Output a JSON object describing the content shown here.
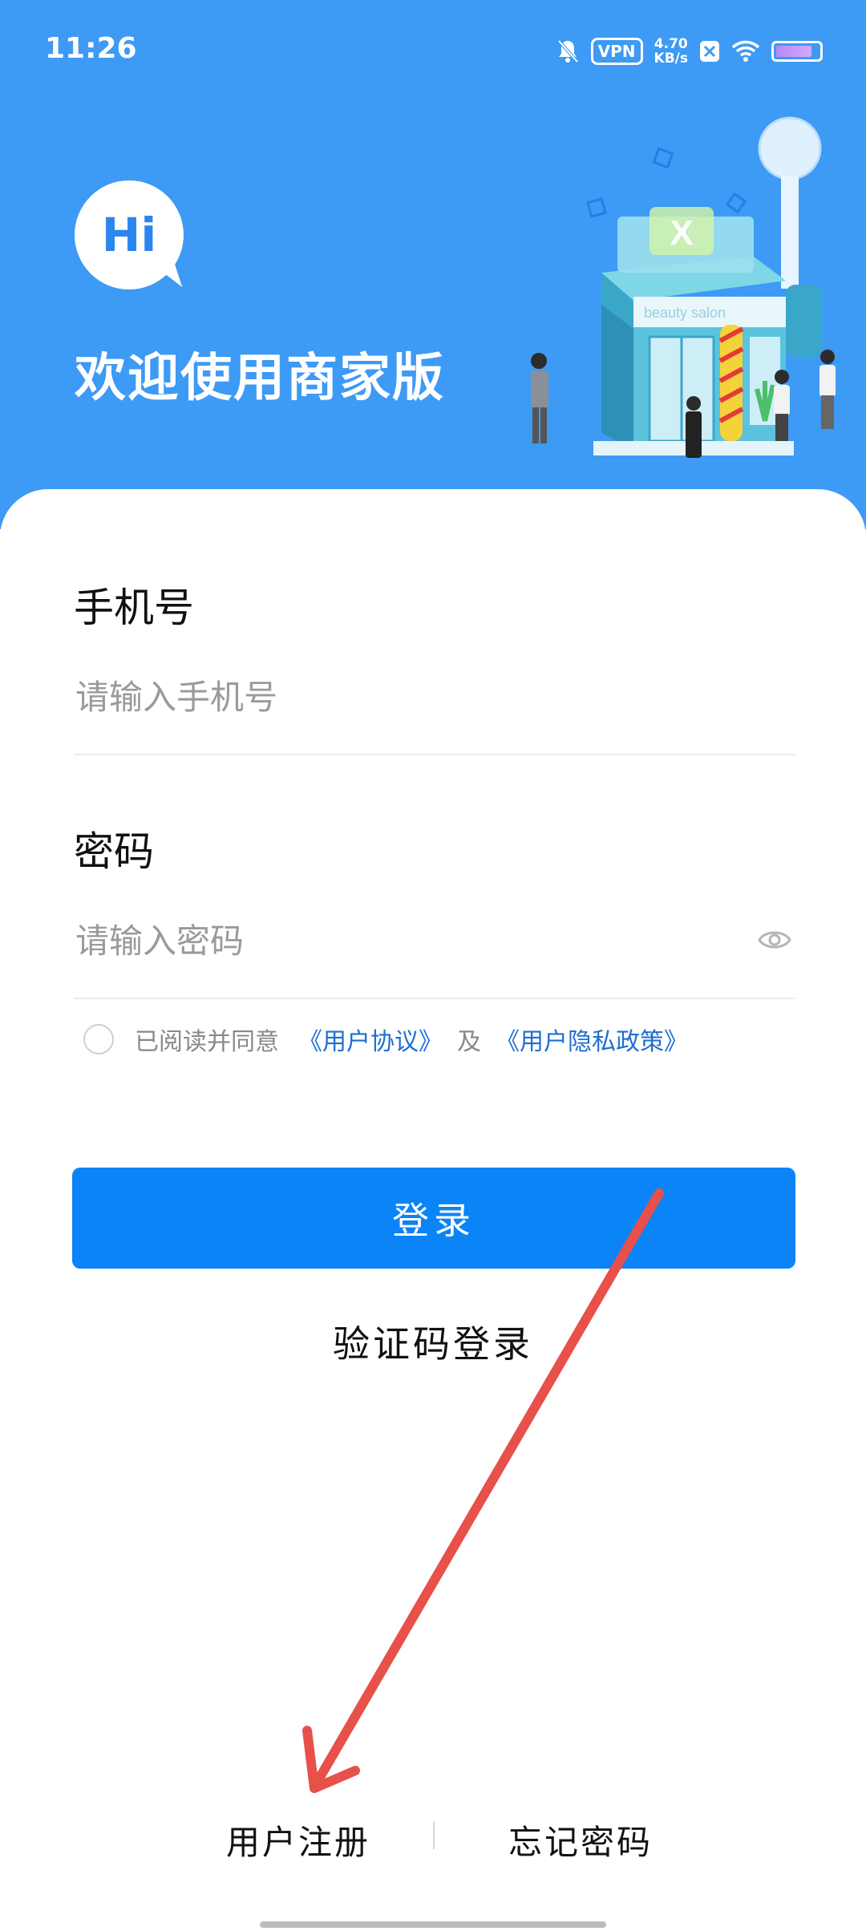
{
  "status_bar": {
    "time": "11:26",
    "vpn": "VPN",
    "speed_value": "4.70",
    "speed_unit": "KB/s",
    "battery_level": 0.85
  },
  "header": {
    "hi": "Hi",
    "title": "欢迎使用商家版",
    "illustration_text": "beauty salon"
  },
  "form": {
    "phone_label": "手机号",
    "phone_placeholder": "请输入手机号",
    "password_label": "密码",
    "password_placeholder": "请输入密码",
    "agree_text": "已阅读并同意",
    "user_agreement": "《用户协议》",
    "and": "及",
    "privacy_policy": "《用户隐私政策》",
    "login_button": "登录",
    "sms_login": "验证码登录"
  },
  "footer": {
    "register": "用户注册",
    "forgot_password": "忘记密码"
  },
  "colors": {
    "header_bg": "#3d9af5",
    "primary_button": "#0a84f7",
    "link": "#1e6fd0",
    "annotation_arrow": "#e8504a"
  }
}
